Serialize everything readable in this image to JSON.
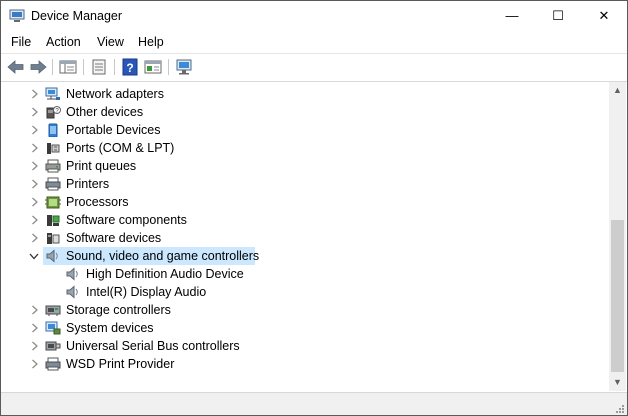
{
  "window": {
    "title": "Device Manager"
  },
  "controls": {
    "minimize": "—",
    "maximize": "☐",
    "close": "✕"
  },
  "menu": [
    "File",
    "Action",
    "View",
    "Help"
  ],
  "toolbar": {
    "items": [
      "back-icon",
      "forward-icon",
      "show-hide-tree-icon",
      "properties-icon",
      "help-icon",
      "update-driver-icon",
      "scan-hardware-icon"
    ]
  },
  "tree": {
    "items": [
      {
        "label": "Network adapters",
        "icon": "network-adapter-icon",
        "level": 1,
        "expander": "collapsed"
      },
      {
        "label": "Other devices",
        "icon": "unknown-device-icon",
        "level": 1,
        "expander": "collapsed"
      },
      {
        "label": "Portable Devices",
        "icon": "portable-device-icon",
        "level": 1,
        "expander": "collapsed"
      },
      {
        "label": "Ports (COM & LPT)",
        "icon": "port-icon",
        "level": 1,
        "expander": "collapsed"
      },
      {
        "label": "Print queues",
        "icon": "print-queue-icon",
        "level": 1,
        "expander": "collapsed"
      },
      {
        "label": "Printers",
        "icon": "printer-icon",
        "level": 1,
        "expander": "collapsed"
      },
      {
        "label": "Processors",
        "icon": "processor-icon",
        "level": 1,
        "expander": "collapsed"
      },
      {
        "label": "Software components",
        "icon": "software-component-icon",
        "level": 1,
        "expander": "collapsed"
      },
      {
        "label": "Software devices",
        "icon": "software-device-icon",
        "level": 1,
        "expander": "collapsed"
      },
      {
        "label": "Sound, video and game controllers",
        "icon": "speaker-icon",
        "level": 1,
        "expander": "expanded",
        "selected": true
      },
      {
        "label": "High Definition Audio Device",
        "icon": "speaker-icon",
        "level": 2
      },
      {
        "label": "Intel(R) Display Audio",
        "icon": "speaker-icon",
        "level": 2
      },
      {
        "label": "Storage controllers",
        "icon": "storage-controller-icon",
        "level": 1,
        "expander": "collapsed"
      },
      {
        "label": "System devices",
        "icon": "system-device-icon",
        "level": 1,
        "expander": "collapsed"
      },
      {
        "label": "Universal Serial Bus controllers",
        "icon": "usb-controller-icon",
        "level": 1,
        "expander": "collapsed"
      },
      {
        "label": "WSD Print Provider",
        "icon": "printer-icon",
        "level": 1,
        "expander": "collapsed"
      }
    ]
  },
  "scrollbar": {
    "position": 0.88
  },
  "colors": {
    "selection": "#cce8ff",
    "accent": "#0078d7"
  }
}
